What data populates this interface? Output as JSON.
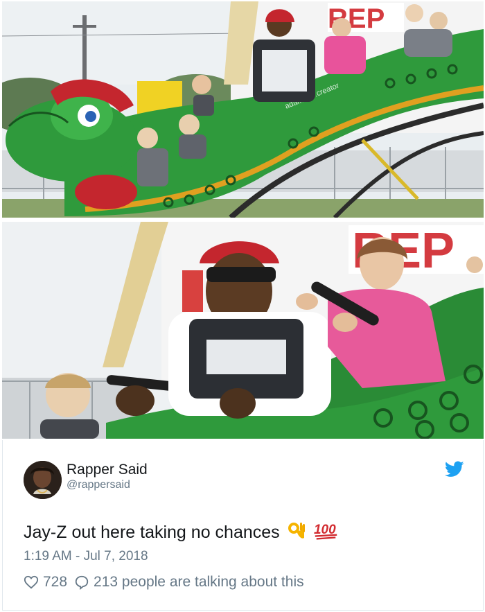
{
  "images": {
    "top_alt": "",
    "watermark": "adam.the.creator",
    "sign_text": "REP"
  },
  "tweet": {
    "display_name": "Rapper Said",
    "handle": "@rappersaid",
    "text": "Jay-Z out here taking no chances",
    "emojis": [
      "ok-hand-emoji",
      "hundred-points-emoji"
    ],
    "timestamp": "1:19 AM - Jul 7, 2018",
    "likes": "728",
    "talking": "213 people are talking about this"
  },
  "colors": {
    "twitter_blue": "#1da1f2",
    "text_primary": "#14171a",
    "text_secondary": "#657786",
    "coaster_green": "#2f9a3c",
    "helmet_red": "#c4262e"
  },
  "icons": {
    "brand": "twitter-bird-icon",
    "like": "heart-icon",
    "reply": "speech-bubble-icon"
  }
}
